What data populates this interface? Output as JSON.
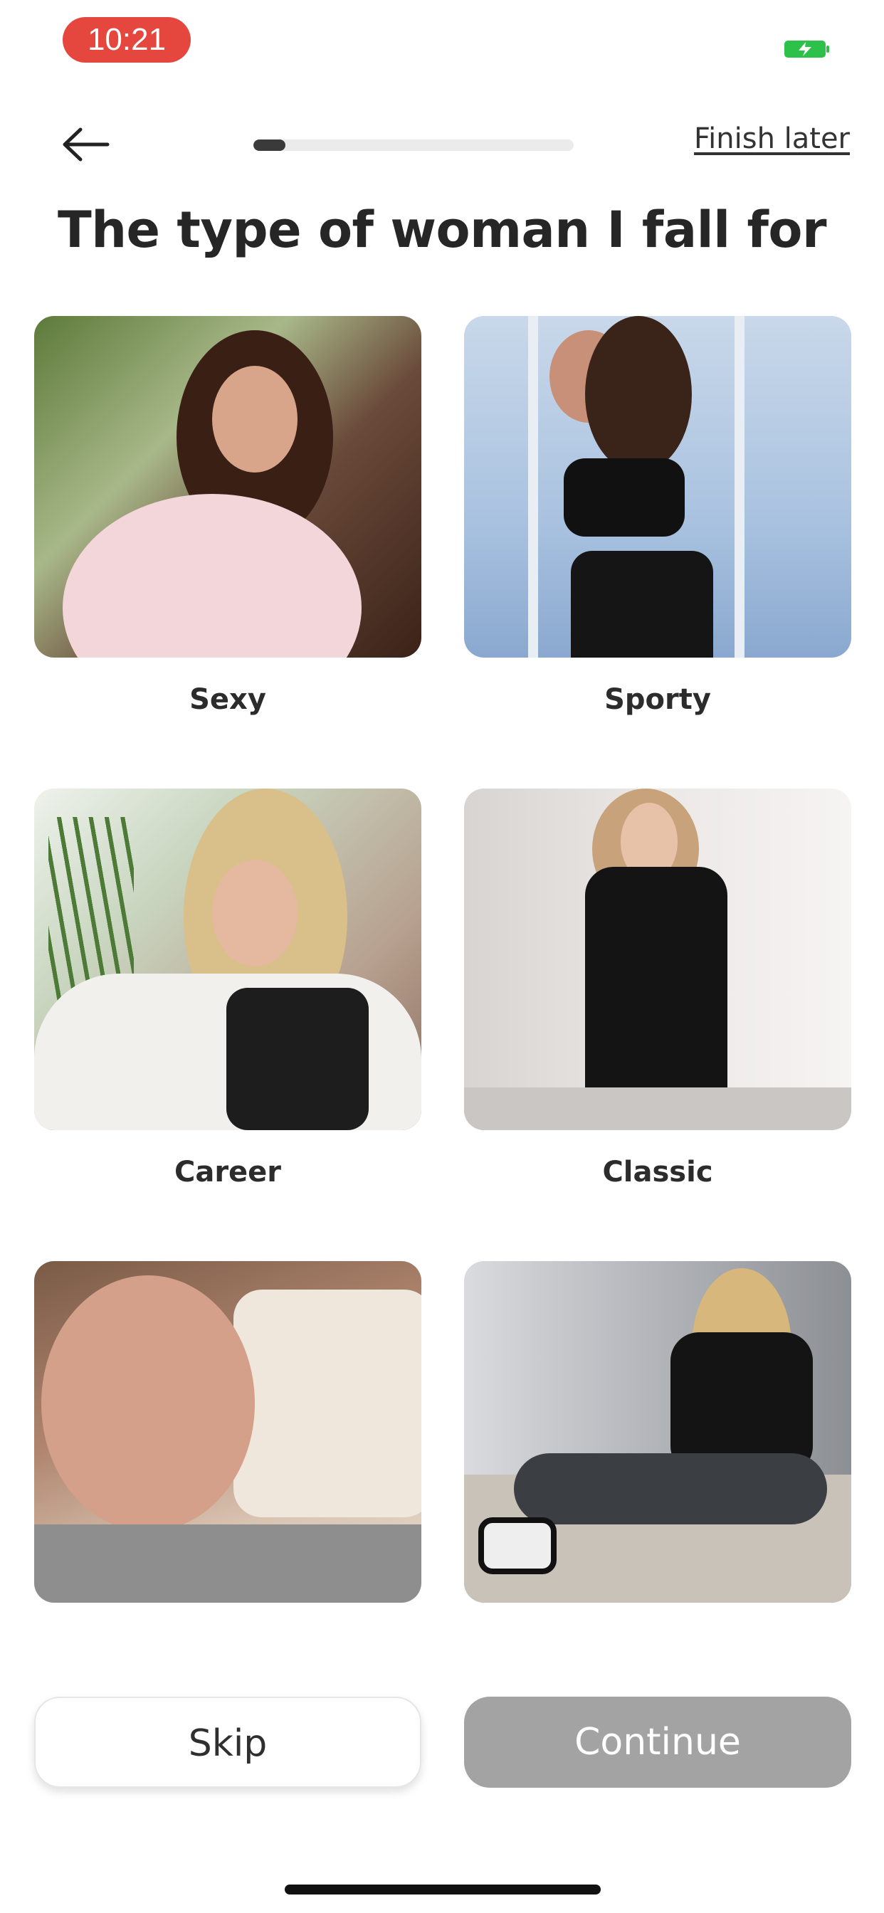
{
  "status_bar": {
    "time": "10:21",
    "battery_icon": "battery-charging-icon",
    "time_badge_color": "#e5463e",
    "battery_color": "#2ec14a"
  },
  "header": {
    "back_icon": "arrow-left-icon",
    "progress": 0.1,
    "finish_later_label": "Finish later"
  },
  "page_title": "The type of woman I fall for",
  "choices": [
    {
      "label": "Sexy",
      "image": "woman-white-top-photo"
    },
    {
      "label": "Sporty",
      "image": "woman-sports-bra-photo"
    },
    {
      "label": "Career",
      "image": "woman-glasses-blouse-photo"
    },
    {
      "label": "Classic",
      "image": "woman-black-blazer-dress-photo"
    },
    {
      "label": "",
      "image": "woman-pillow-selfie-photo"
    },
    {
      "label": "",
      "image": "woman-sitting-jeans-sneakers-photo"
    }
  ],
  "buttons": {
    "skip_label": "Skip",
    "continue_label": "Continue",
    "continue_color": "#a3a3a3"
  }
}
